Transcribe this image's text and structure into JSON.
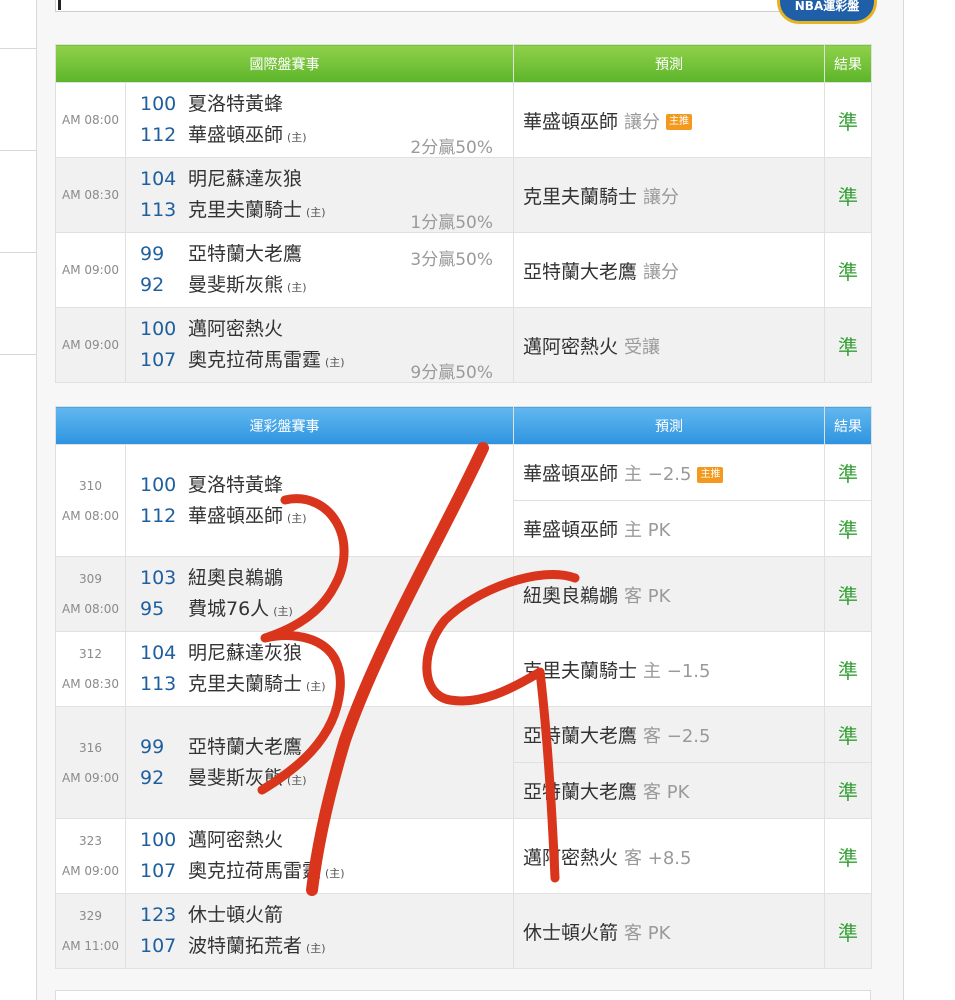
{
  "brand": {
    "logo_text": "NBA運彩盤"
  },
  "colors": {
    "international_header": "#6cc33a",
    "sports_lottery_header": "#3fa2e6",
    "result_green": "#34a034",
    "score_blue": "#1f5f9e",
    "tag_orange": "#f39a1e"
  },
  "international": {
    "headers": {
      "games": "國際盤賽事",
      "prediction": "預測",
      "result": "結果"
    },
    "rows": [
      {
        "time": "AM 08:00",
        "away_score": "100",
        "away_team": "夏洛特黃蜂",
        "home_score": "112",
        "home_team": "華盛頓巫師",
        "home_mark": "(主)",
        "spread": "2分贏50%",
        "pick_team": "華盛頓巫師",
        "pick_type": "讓分",
        "tag": "主推",
        "result": "準"
      },
      {
        "time": "AM 08:30",
        "away_score": "104",
        "away_team": "明尼蘇達灰狼",
        "home_score": "113",
        "home_team": "克里夫蘭騎士",
        "home_mark": "(主)",
        "spread": "1分贏50%",
        "pick_team": "克里夫蘭騎士",
        "pick_type": "讓分",
        "result": "準"
      },
      {
        "time": "AM 09:00",
        "away_score": "99",
        "away_team": "亞特蘭大老鷹",
        "home_score": "92",
        "home_team": "曼斐斯灰熊",
        "home_mark": "(主)",
        "spread": "3分贏50%",
        "pick_team": "亞特蘭大老鷹",
        "pick_type": "讓分",
        "result": "準"
      },
      {
        "time": "AM 09:00",
        "away_score": "100",
        "away_team": "邁阿密熱火",
        "home_score": "107",
        "home_team": "奧克拉荷馬雷霆",
        "home_mark": "(主)",
        "spread": "9分贏50%",
        "pick_team": "邁阿密熱火",
        "pick_type": "受讓",
        "result": "準"
      }
    ]
  },
  "sports_lottery": {
    "headers": {
      "games": "運彩盤賽事",
      "prediction": "預測",
      "result": "結果"
    },
    "rows": [
      {
        "code": "310",
        "time": "AM 08:00",
        "away_score": "100",
        "away_team": "夏洛特黃蜂",
        "home_score": "112",
        "home_team": "華盛頓巫師",
        "home_mark": "(主)",
        "picks": [
          {
            "team": "華盛頓巫師",
            "line": "主 −2.5",
            "tag": "主推",
            "result": "準"
          },
          {
            "team": "華盛頓巫師",
            "line": "主 PK",
            "result": "準"
          }
        ]
      },
      {
        "code": "309",
        "time": "AM 08:00",
        "away_score": "103",
        "away_team": "紐奧良鵜鶘",
        "home_score": "95",
        "home_team": "費城76人",
        "home_mark": "(主)",
        "picks": [
          {
            "team": "紐奧良鵜鶘",
            "line": "客 PK",
            "result": "準"
          }
        ]
      },
      {
        "code": "312",
        "time": "AM 08:30",
        "away_score": "104",
        "away_team": "明尼蘇達灰狼",
        "home_score": "113",
        "home_team": "克里夫蘭騎士",
        "home_mark": "(主)",
        "picks": [
          {
            "team": "克里夫蘭騎士",
            "line": "主 −1.5",
            "result": "準"
          }
        ]
      },
      {
        "code": "316",
        "time": "AM 09:00",
        "away_score": "99",
        "away_team": "亞特蘭大老鷹",
        "home_score": "92",
        "home_team": "曼斐斯灰熊",
        "home_mark": "(主)",
        "picks": [
          {
            "team": "亞特蘭大老鷹",
            "line": "客 −2.5",
            "result": "準"
          },
          {
            "team": "亞特蘭大老鷹",
            "line": "客 PK",
            "result": "準"
          }
        ]
      },
      {
        "code": "323",
        "time": "AM 09:00",
        "away_score": "100",
        "away_team": "邁阿密熱火",
        "home_score": "107",
        "home_team": "奧克拉荷馬雷霆",
        "home_mark": "(主)",
        "picks": [
          {
            "team": "邁阿密熱火",
            "line": "客 +8.5",
            "result": "準"
          }
        ]
      },
      {
        "code": "329",
        "time": "AM 11:00",
        "away_score": "123",
        "away_team": "休士頓火箭",
        "home_score": "107",
        "home_team": "波特蘭拓荒者",
        "home_mark": "(主)",
        "picks": [
          {
            "team": "休士頓火箭",
            "line": "客 PK",
            "result": "準"
          }
        ]
      }
    ]
  },
  "annotation": {
    "icon": "handwritten-3-4-scribble",
    "color": "#d9341c"
  }
}
